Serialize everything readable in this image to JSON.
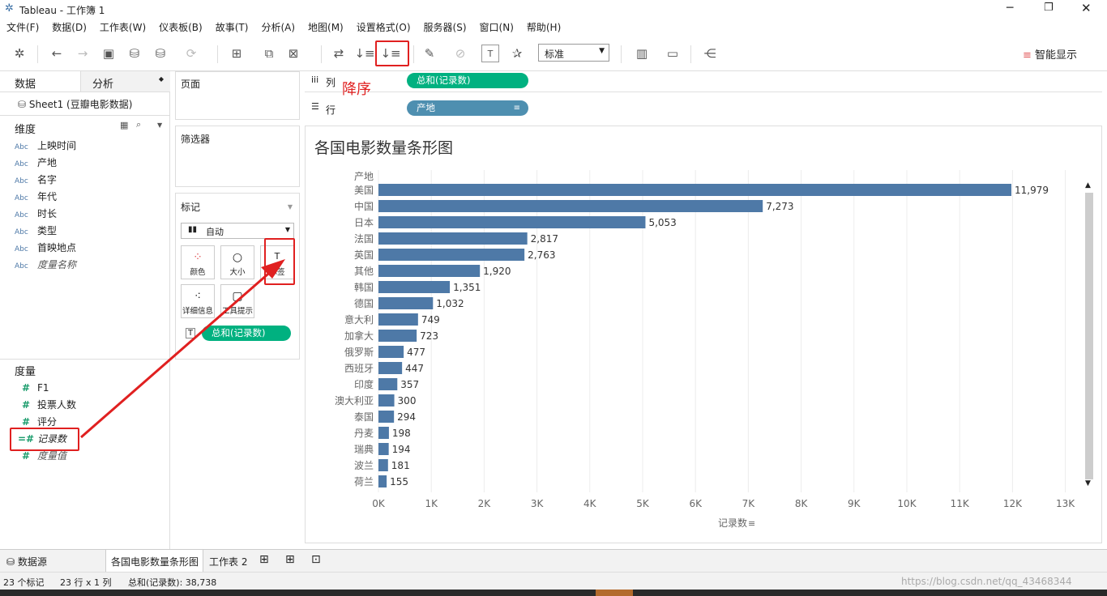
{
  "window": {
    "title": "Tableau - 工作簿 1"
  },
  "menu": [
    "文件(F)",
    "数据(D)",
    "工作表(W)",
    "仪表板(B)",
    "故事(T)",
    "分析(A)",
    "地图(M)",
    "设置格式(O)",
    "服务器(S)",
    "窗口(N)",
    "帮助(H)"
  ],
  "toolbar": {
    "fit_select": "标准",
    "show_me": "智能显示",
    "sort_desc_note": "降序"
  },
  "left": {
    "tab_data": "数据",
    "tab_analysis": "分析",
    "datasource": "Sheet1 (豆瓣电影数据)",
    "dimensions_title": "维度",
    "dimensions": [
      "上映时间",
      "产地",
      "名字",
      "年代",
      "时长",
      "类型",
      "首映地点",
      "度量名称"
    ],
    "dim_icon": "Abc",
    "measures_title": "度量",
    "measures": [
      "F1",
      "投票人数",
      "评分",
      "记录数",
      "度量值"
    ]
  },
  "shelves": {
    "pages": "页面",
    "filters": "筛选器",
    "marks": "标记",
    "mark_type": "自动",
    "mark_buttons": [
      "颜色",
      "大小",
      "标签",
      "详细信息",
      "工具提示"
    ],
    "mark_pill": "总和(记录数)",
    "columns_label": "列",
    "rows_label": "行",
    "columns_pill": "总和(记录数)",
    "rows_pill": "产地"
  },
  "chart_data": {
    "type": "bar",
    "title": "各国电影数量条形图",
    "row_header": "产地",
    "categories": [
      "美国",
      "中国",
      "日本",
      "法国",
      "英国",
      "其他",
      "韩国",
      "德国",
      "意大利",
      "加拿大",
      "俄罗斯",
      "西班牙",
      "印度",
      "澳大利亚",
      "泰国",
      "丹麦",
      "瑞典",
      "波兰",
      "荷兰"
    ],
    "values": [
      11979,
      7273,
      5053,
      2817,
      2763,
      1920,
      1351,
      1032,
      749,
      723,
      477,
      447,
      357,
      300,
      294,
      198,
      194,
      181,
      155
    ],
    "value_labels": [
      "11,979",
      "7,273",
      "5,053",
      "2,817",
      "2,763",
      "1,920",
      "1,351",
      "1,032",
      "749",
      "723",
      "477",
      "447",
      "357",
      "300",
      "294",
      "198",
      "194",
      "181",
      "155"
    ],
    "xticks": [
      "0K",
      "1K",
      "2K",
      "3K",
      "4K",
      "5K",
      "6K",
      "7K",
      "8K",
      "9K",
      "10K",
      "11K",
      "12K",
      "13K"
    ],
    "xlim": [
      0,
      13000
    ],
    "xlabel": "记录数",
    "bar_color": "#4e79a7",
    "grid": true
  },
  "tabs": {
    "datasource": "数据源",
    "sheet1": "各国电影数量条形图",
    "sheet2": "工作表 2"
  },
  "status": {
    "marks": "23 个标记",
    "rows_cols": "23 行 x 1 列",
    "sum": "总和(记录数): 38,738"
  },
  "watermark": "https://blog.csdn.net/qq_43468344"
}
